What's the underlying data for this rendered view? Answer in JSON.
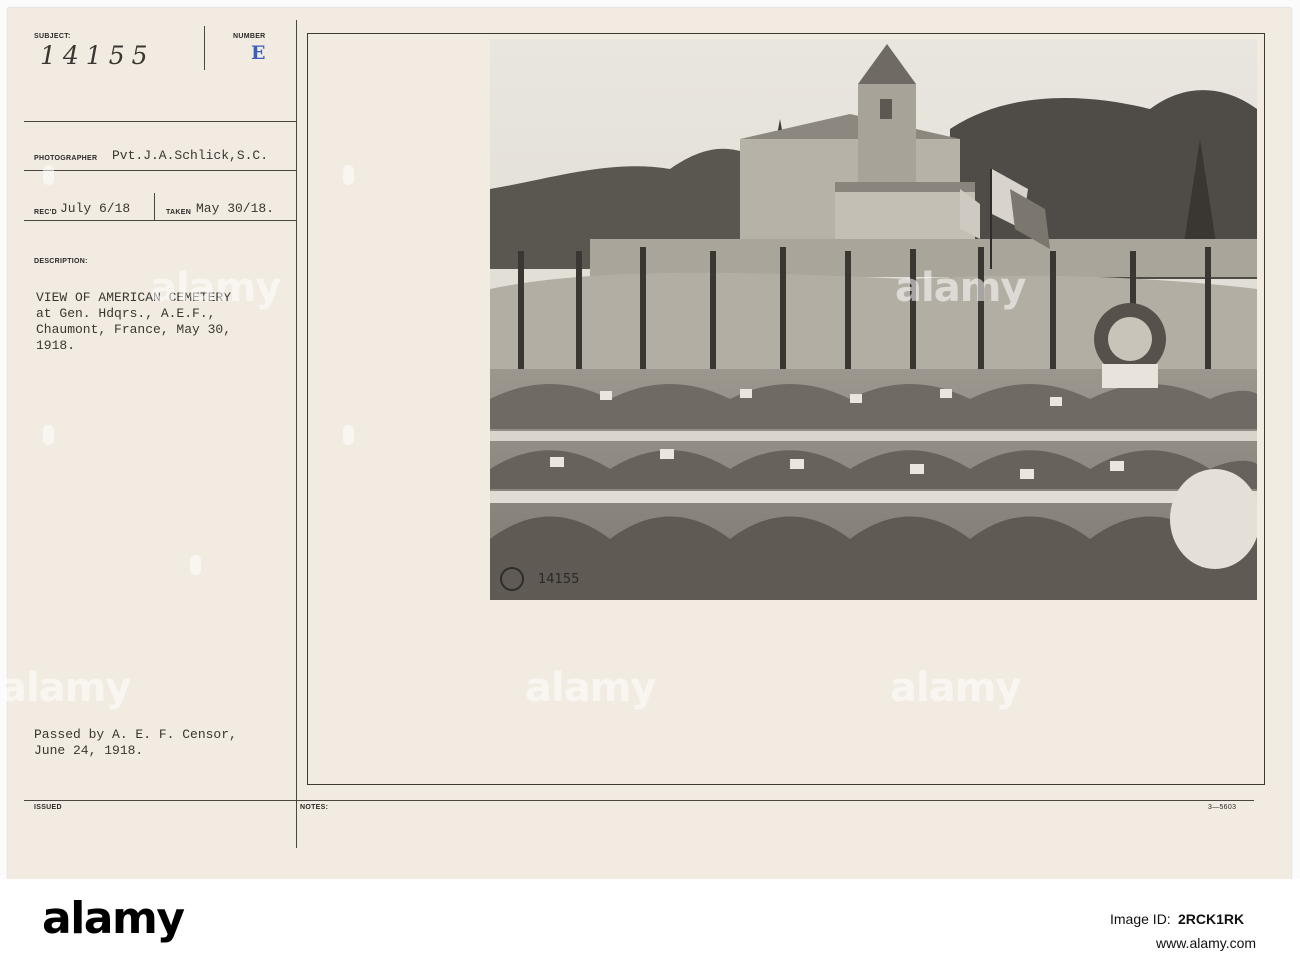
{
  "header": {
    "subject_label": "SUBJECT:",
    "subject_value": "14155",
    "number_label": "NUMBER",
    "number_value": "E"
  },
  "photographer": {
    "label": "PHOTOGRAPHER",
    "value": "Pvt.J.A.Schlick,S.C."
  },
  "dates": {
    "received_label": "REC'D",
    "received_value": "July 6/18",
    "taken_label": "TAKEN",
    "taken_value": "May 30/18."
  },
  "description": {
    "label": "DESCRIPTION:",
    "lines": [
      "VIEW OF AMERICAN CEMETERY",
      "at Gen. Hdqrs., A.E.F.,",
      "Chaumont, France, May 30,",
      "1918."
    ]
  },
  "censor": {
    "lines": [
      "Passed by A. E. F. Censor,",
      "June 24, 1918."
    ]
  },
  "footer": {
    "issued_label": "ISSUED",
    "notes_label": "NOTES:",
    "form_number": "3—5603"
  },
  "photo": {
    "negative_number": "14155",
    "stamp_text": "S.C. USA"
  },
  "watermark": {
    "text": "alamy"
  },
  "bottom_bar": {
    "logo": "alamy",
    "image_id_label": "Image ID:",
    "image_id": "2RCK1RK",
    "site": "www.alamy.com"
  },
  "colors": {
    "card": "#f1ebe1",
    "typed_black": "#3a3632",
    "typed_red": "#b8323b",
    "number_blue": "#3b5fb8"
  }
}
